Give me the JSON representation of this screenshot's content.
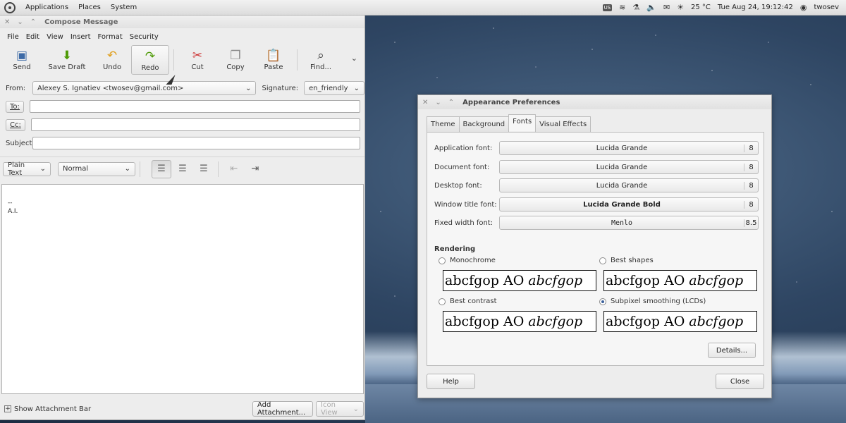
{
  "top_panel": {
    "menus": [
      "Applications",
      "Places",
      "System"
    ],
    "keyboard_layout": "US",
    "temperature": "25 °C",
    "datetime": "Tue Aug 24, 19:12:42",
    "user": "twosev"
  },
  "compose": {
    "title": "Compose Message",
    "menus": [
      "File",
      "Edit",
      "View",
      "Insert",
      "Format",
      "Security"
    ],
    "toolbar": {
      "send": "Send",
      "save_draft": "Save Draft",
      "undo": "Undo",
      "redo": "Redo",
      "cut": "Cut",
      "copy": "Copy",
      "paste": "Paste",
      "find": "Find..."
    },
    "from_label": "From:",
    "from_value": "Alexey S. Ignatiev <twosev@gmail.com>",
    "signature_label": "Signature:",
    "signature_value": "en_friendly",
    "to_label": "To:",
    "cc_label": "Cc:",
    "subject_label": "Subject:",
    "format_mode": "Plain Text",
    "paragraph_style": "Normal",
    "body_line1": "--",
    "body_line2": "A.I.",
    "show_attachment_bar": "Show Attachment Bar",
    "add_attachment": "Add Attachment...",
    "icon_view": "Icon View"
  },
  "appearance": {
    "title": "Appearance Preferences",
    "tabs": [
      "Theme",
      "Background",
      "Fonts",
      "Visual Effects"
    ],
    "fonts": [
      {
        "label": "Application font:",
        "font": "Lucida Grande",
        "size": "8"
      },
      {
        "label": "Document font:",
        "font": "Lucida Grande",
        "size": "8"
      },
      {
        "label": "Desktop font:",
        "font": "Lucida Grande",
        "size": "8"
      },
      {
        "label": "Window title font:",
        "font": "Lucida Grande Bold",
        "size": "8"
      },
      {
        "label": "Fixed width font:",
        "font": "Menlo",
        "size": "8.5"
      }
    ],
    "rendering_title": "Rendering",
    "options": [
      "Monochrome",
      "Best shapes",
      "Best contrast",
      "Subpixel smoothing (LCDs)"
    ],
    "sample_normal": "abcfgop AO",
    "sample_italic": "abcfgop",
    "details": "Details...",
    "help": "Help",
    "close": "Close"
  }
}
